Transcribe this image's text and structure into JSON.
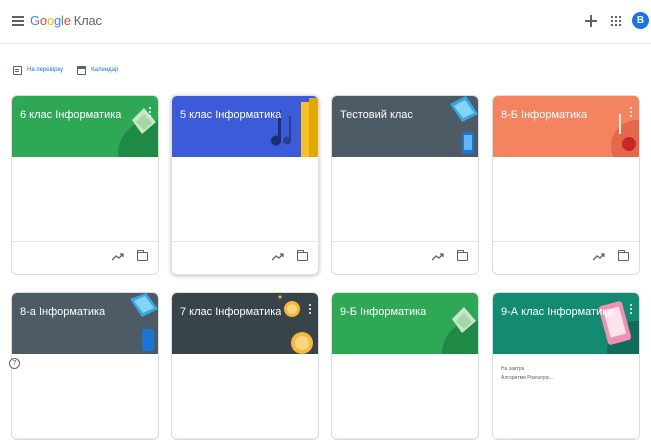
{
  "header": {
    "brand": {
      "g": "G",
      "o1": "o",
      "o2": "o",
      "g2": "g",
      "l": "l",
      "e": "e",
      "name": "Клас"
    },
    "avatar_letter": "В"
  },
  "subnav": {
    "review_label": "На перевірку",
    "calendar_label": "Календар"
  },
  "classes": [
    {
      "title": "6 клас Інформатика",
      "color": "#2fa855"
    },
    {
      "title": "5 клас Інформатика",
      "color": "#3b5bd9"
    },
    {
      "title": "Тестовий клас",
      "color": "#4d5b64"
    },
    {
      "title": "8-Б Інформатика",
      "color": "#f4845f"
    },
    {
      "title": "8-а Інформатика",
      "color": "#4d5b64"
    },
    {
      "title": "7 клас Інформатика",
      "color": "#38434a"
    },
    {
      "title": "9-Б Інформатика",
      "color": "#2fa855"
    },
    {
      "title": "9-А клас Інформатика",
      "color": "#138a72",
      "due_label": "На завтра",
      "due_item": "Алгоритми Розгалуж..."
    }
  ],
  "colors": {
    "accent": "#1a73e8",
    "icon": "#5f6368"
  }
}
